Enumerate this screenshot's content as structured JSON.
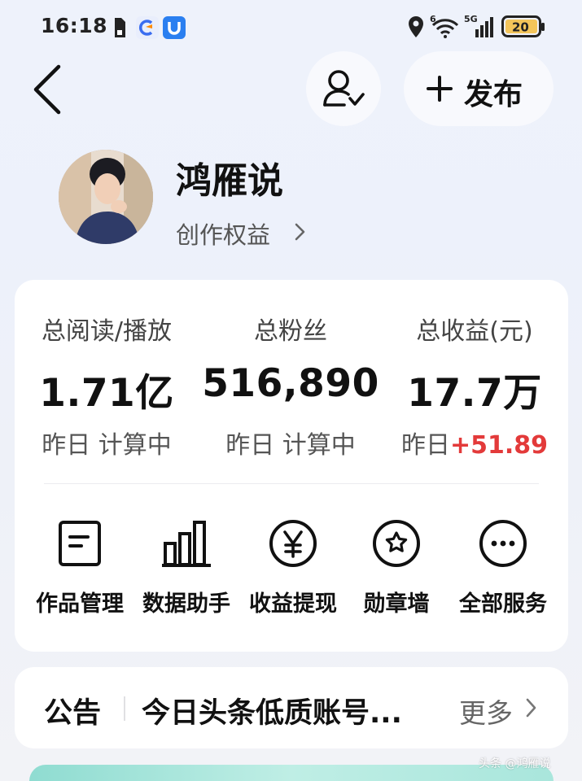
{
  "status_bar": {
    "time": "16:18",
    "battery": "20",
    "network": "5G",
    "icons": [
      "sim-icon",
      "clear-app-icon",
      "shield-app-icon",
      "location-icon",
      "wifi-icon",
      "signal-icon",
      "battery-icon"
    ]
  },
  "header": {
    "publish_label": "+ 发布",
    "publish_text": "发布"
  },
  "profile": {
    "name": "鸿雁说",
    "creator_link": "创作权益"
  },
  "stats": [
    {
      "label": "总阅读/播放",
      "value": "1.71亿",
      "sub_prefix": "昨日 ",
      "sub_value": "计算中",
      "sub_highlight": false
    },
    {
      "label": "总粉丝",
      "value": "516,890",
      "sub_prefix": "昨日 ",
      "sub_value": "计算中",
      "sub_highlight": false
    },
    {
      "label": "总收益(元)",
      "value": "17.7万",
      "sub_prefix": "昨日",
      "sub_value": "+51.89",
      "sub_highlight": true
    }
  ],
  "services": [
    {
      "label": "作品管理",
      "icon": "document-icon"
    },
    {
      "label": "数据助手",
      "icon": "bar-chart-icon"
    },
    {
      "label": "收益提现",
      "icon": "yen-icon"
    },
    {
      "label": "勋章墙",
      "icon": "badge-star-icon"
    },
    {
      "label": "全部服务",
      "icon": "more-icon"
    }
  ],
  "notice": {
    "title": "公告",
    "text": "今日头条低质账号...",
    "more": "更多"
  },
  "colors": {
    "accent_red": "#e33a3a",
    "background": "#eef2fb",
    "card": "#ffffff"
  },
  "watermark": "头条 @鸿雁说"
}
